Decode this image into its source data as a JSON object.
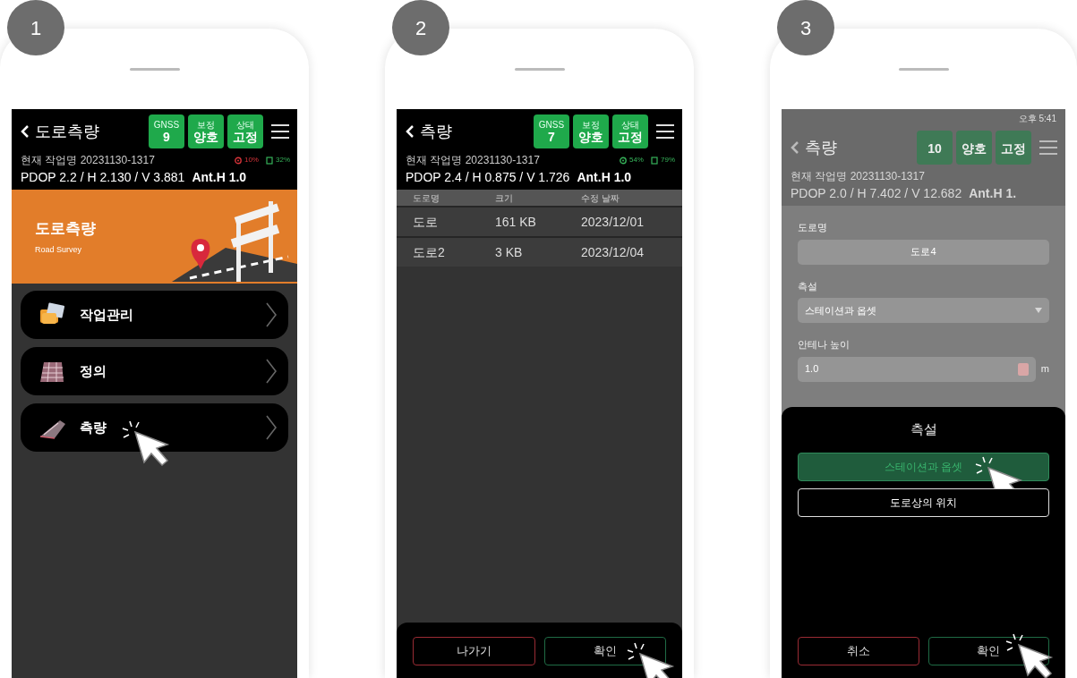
{
  "phones": [
    {
      "kind": "menu",
      "step": "1",
      "header": {
        "title": "도로측량",
        "badges": [
          {
            "label": "GNSS",
            "value": "9"
          },
          {
            "label": "보정",
            "value": "양호"
          },
          {
            "label": "상태",
            "value": "고정"
          }
        ],
        "job": "현재 작업명 20231130-1317",
        "signal": "10%",
        "signal_low": true,
        "battery": "32%",
        "precision": "PDOP 2.2 / H 2.130 / V 3.881",
        "antenna": "Ant.H 1.0"
      },
      "banner": {
        "title": "도로측량",
        "subtitle": "Road Survey"
      },
      "menu_items": [
        {
          "label": "작업관리",
          "cursor": false
        },
        {
          "label": "정의",
          "cursor": false
        },
        {
          "label": "측량",
          "cursor": true
        }
      ]
    },
    {
      "kind": "list",
      "step": "2",
      "header": {
        "title": "측량",
        "badges": [
          {
            "label": "GNSS",
            "value": "7"
          },
          {
            "label": "보정",
            "value": "양호"
          },
          {
            "label": "상태",
            "value": "고정"
          }
        ],
        "job": "현재 작업명 20231130-1317",
        "signal": "54%",
        "signal_low": false,
        "battery": "79%",
        "precision": "PDOP 2.4 / H 0.875 / V 1.726",
        "antenna": "Ant.H 1.0"
      },
      "table": {
        "columns": [
          "도로명",
          "크기",
          "수정 날짜"
        ],
        "rows": [
          [
            "도로",
            "161 KB",
            "2023/12/01"
          ],
          [
            "도로2",
            "3 KB",
            "2023/12/04"
          ]
        ]
      },
      "buttons": [
        {
          "label": "나가기",
          "kind": "cancel",
          "cursor": false
        },
        {
          "label": "확인",
          "kind": "confirm",
          "cursor": true
        }
      ]
    },
    {
      "kind": "dialog",
      "step": "3",
      "status_time": "오후 5:41",
      "header": {
        "title": "측량",
        "badges": [
          {
            "value": "10"
          },
          {
            "value": "양호"
          },
          {
            "value": "고정"
          }
        ],
        "job": "현재 작업명 20231130-1317",
        "precision": "PDOP 2.0 / H 7.402 / V 12.682",
        "antenna": "Ant.H  1."
      },
      "fields": [
        {
          "kind": "text",
          "label": "도로명",
          "value": "도로4"
        },
        {
          "kind": "select",
          "label": "측설",
          "value": "스테이션과 옵셋"
        },
        {
          "kind": "number",
          "label": "안테나 높이",
          "value": "1.0",
          "unit": "m"
        }
      ],
      "sheet": {
        "title": "측설",
        "options": [
          {
            "label": "스테이션과 옵셋",
            "selected": true,
            "cursor": true
          },
          {
            "label": "도로상의 위치",
            "selected": false,
            "cursor": false
          }
        ],
        "buttons": [
          {
            "label": "취소",
            "kind": "cancel",
            "cursor": false
          },
          {
            "label": "확인",
            "kind": "confirm",
            "cursor": true
          }
        ]
      }
    }
  ]
}
